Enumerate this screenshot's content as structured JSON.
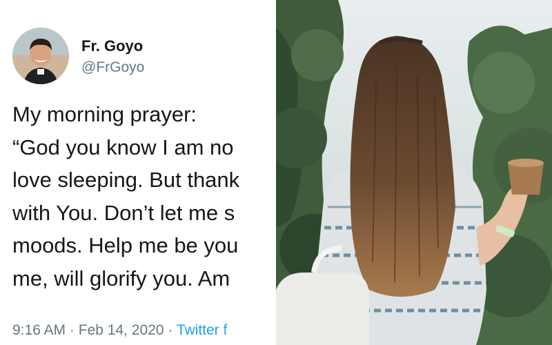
{
  "tweet": {
    "display_name": "Fr. Goyo",
    "handle": "@FrGoyo",
    "lines": [
      "My morning prayer:",
      "“God you know I am no",
      "love sleeping. But thank",
      "with You. Don’t let me s",
      "moods. Help me be you",
      "me, will glorify you. Am"
    ],
    "time": "9:16 AM",
    "separator": "·",
    "date": "Feb 14, 2020",
    "source": "Twitter f"
  },
  "colors": {
    "text": "#14171a",
    "secondary": "#657786",
    "link": "#1da1f2"
  },
  "photo": {
    "subject": "woman-with-long-hair-holding-cup"
  }
}
